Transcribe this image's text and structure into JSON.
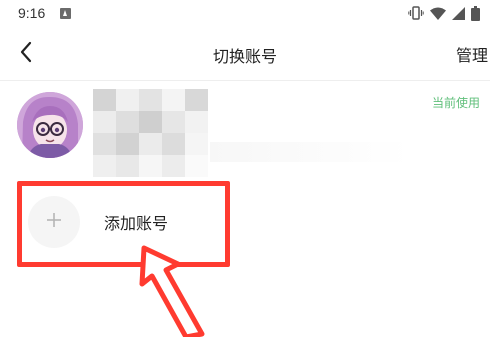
{
  "status_bar": {
    "time": "9:16",
    "icons": [
      "app-notification-icon",
      "vibrate-icon",
      "wifi-icon",
      "signal-icon",
      "battery-icon"
    ]
  },
  "header": {
    "back_icon": "chevron-left-icon",
    "title": "切换账号",
    "manage_label": "管理"
  },
  "current_account": {
    "status_label": "当前使用",
    "status_color": "#5fbf7a"
  },
  "add_account": {
    "icon": "plus-icon",
    "label": "添加账号",
    "highlight_color": "#ff3b30"
  }
}
